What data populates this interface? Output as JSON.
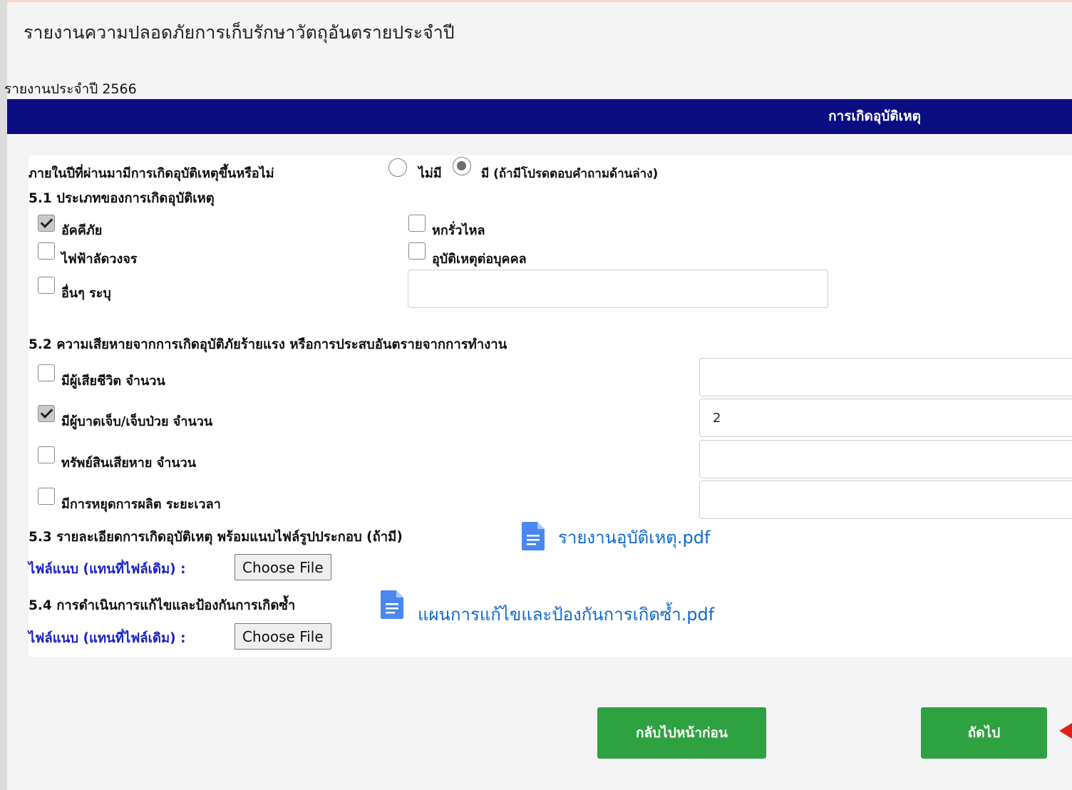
{
  "page": {
    "title": "รายงานความปลอดภัยการเก็บรักษาวัตถุอันตรายประจำปี",
    "year_label": "รายงานประจำปี 2566"
  },
  "section_header": "การเกิดอุบัติเหตุ",
  "question": {
    "label": "ภายในปีที่ผ่านมามีการเกิดอุบัติเหตุขึ้นหรือไม่",
    "option_no": "ไม่มี",
    "option_yes": "มี (ถ้ามีโปรดตอบคำถามด้านล่าง)",
    "selected": "yes"
  },
  "s51": {
    "heading": "5.1 ประเภทของการเกิดอุบัติเหตุ",
    "fire": {
      "label": "อัคคีภัย",
      "checked": true
    },
    "leak": {
      "label": "หกรั่วไหล",
      "checked": false
    },
    "short_circuit": {
      "label": "ไฟฟ้าลัดวงจร",
      "checked": false
    },
    "personal": {
      "label": "อุบัติเหตุต่อบุคคล",
      "checked": false
    },
    "other": {
      "label": "อื่นๆ ระบุ",
      "checked": false,
      "value": ""
    }
  },
  "s52": {
    "heading": "5.2 ความเสียหายจากการเกิดอุบัติภัยร้ายแรง หรือการประสบอันตรายจากการทำงาน",
    "deaths": {
      "label": "มีผู้เสียชีวิต จำนวน",
      "checked": false,
      "value": ""
    },
    "injured": {
      "label": "มีผู้บาดเจ็บ/เจ็บป่วย จำนวน",
      "checked": true,
      "value": "2"
    },
    "property": {
      "label": "ทรัพย์สินเสียหาย จำนวน",
      "checked": false,
      "value": ""
    },
    "production_stop": {
      "label": "มีการหยุดการผลิต ระยะเวลา",
      "checked": false,
      "value": ""
    }
  },
  "s53": {
    "heading": "5.3 รายละเอียดการเกิดอุบัติเหตุ พร้อมแนบไฟล์รูปประกอบ (ถ้ามี)",
    "file_name": "รายงานอุบัติเหตุ.pdf",
    "attach_label": "ไฟล์แนบ (แทนที่ไฟล์เดิม) :",
    "choose_label": "Choose File"
  },
  "s54": {
    "heading": "5.4 การดำเนินการแก้ไขและป้องกันการเกิดซ้ำ",
    "file_name": "แผนการแก้ไขและป้องกันการเกิดซ้ำ.pdf",
    "attach_label": "ไฟล์แนบ (แทนที่ไฟล์เดิม) :",
    "choose_label": "Choose File"
  },
  "buttons": {
    "back": "กลับไปหน้าก่อน",
    "next": "ถัดไป"
  },
  "colors": {
    "header_bg": "#0a0d82",
    "button_green": "#2ea241",
    "link_blue": "#0d6ad1",
    "attach_blue": "#1822c8",
    "arrow_red": "#e0201b"
  }
}
